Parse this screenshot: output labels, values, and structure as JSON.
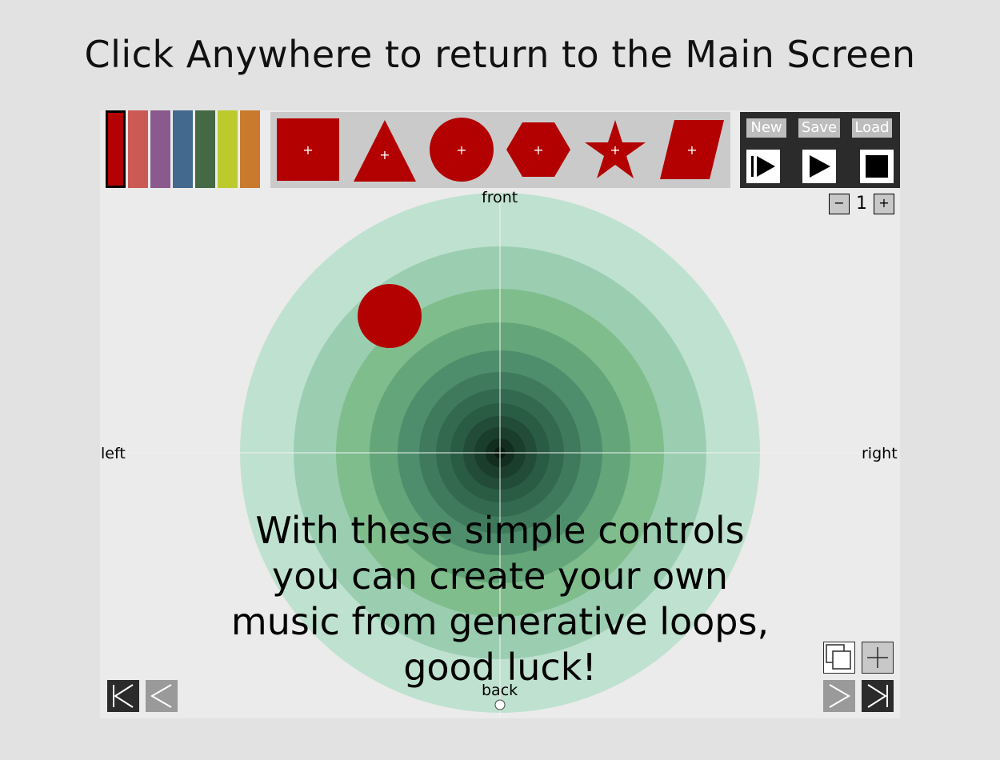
{
  "headline": "Click Anywhere to return to the Main Screen",
  "swatches": [
    {
      "name": "red",
      "color": "#b30000",
      "selected": true
    },
    {
      "name": "salmon",
      "color": "#cc5a54"
    },
    {
      "name": "purple",
      "color": "#8a5a8f"
    },
    {
      "name": "blue",
      "color": "#436a8e"
    },
    {
      "name": "green",
      "color": "#456944"
    },
    {
      "name": "lime",
      "color": "#bdca2e"
    },
    {
      "name": "orange",
      "color": "#c97a2d"
    }
  ],
  "shapes": [
    {
      "name": "square",
      "icon": "square-icon"
    },
    {
      "name": "triangle",
      "icon": "triangle-icon"
    },
    {
      "name": "circle",
      "icon": "circle-icon"
    },
    {
      "name": "hexagon",
      "icon": "hexagon-icon"
    },
    {
      "name": "star",
      "icon": "star-icon"
    },
    {
      "name": "parallelogram",
      "icon": "parallelogram-icon"
    }
  ],
  "shape_color": "#b30000",
  "transport": {
    "new_label": "New",
    "save_label": "Save",
    "load_label": "Load",
    "play_from_start_icon": "play-from-start-icon",
    "play_icon": "play-icon",
    "stop_icon": "stop-icon"
  },
  "stepper": {
    "minus": "−",
    "value": "1",
    "plus": "+"
  },
  "stage": {
    "labels": {
      "front": "front",
      "back": "back",
      "left": "left",
      "right": "right"
    },
    "rings": [
      "#bfe1d0",
      "#9bceb1",
      "#80bd8c",
      "#64a579",
      "#4f8e6c",
      "#3f7a5c",
      "#336a4f",
      "#2a5b43",
      "#224c37",
      "#1a3d2c",
      "#122d20"
    ],
    "placed_shape": {
      "type": "circle",
      "color": "#b30000"
    }
  },
  "caption": [
    "With these simple controls",
    "you can create your own",
    "music from generative loops,",
    "good luck!"
  ],
  "nav": {
    "first_icon": "first-page-icon",
    "prev_icon": "previous-page-icon",
    "next_icon": "next-page-icon",
    "last_icon": "last-page-icon",
    "duplicate_icon": "duplicate-icon",
    "add_icon": "add-icon"
  }
}
